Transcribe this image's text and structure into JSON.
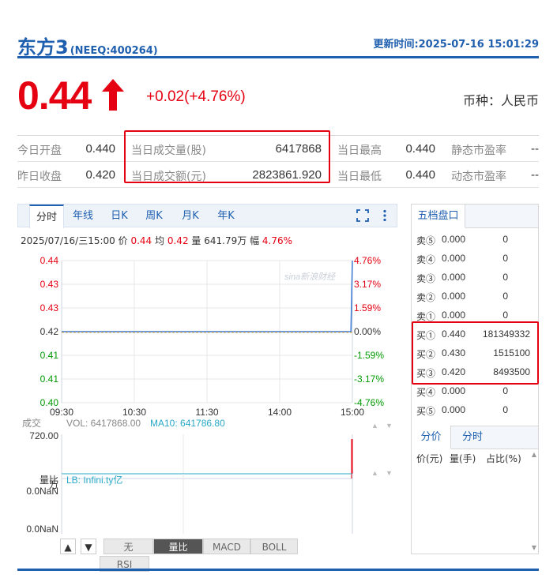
{
  "header": {
    "name": "东方3",
    "code": "(NEEQ:400264)",
    "update_time": "更新时间:2025-07-16 15:01:29"
  },
  "quote": {
    "price": "0.44",
    "change": "+0.02(+4.76%)",
    "currency": "币种：人民币"
  },
  "stats": {
    "row1": [
      {
        "label": "今日开盘",
        "value": "0.440"
      },
      {
        "label": "当日成交量(股)",
        "value": "6417868"
      },
      {
        "label": "当日最高",
        "value": "0.440"
      },
      {
        "label": "静态市盈率",
        "value": "--"
      }
    ],
    "row2": [
      {
        "label": "昨日收盘",
        "value": "0.420"
      },
      {
        "label": "当日成交额(元)",
        "value": "2823861.920"
      },
      {
        "label": "当日最低",
        "value": "0.440"
      },
      {
        "label": "动态市盈率",
        "value": "--"
      }
    ]
  },
  "chart_tabs": [
    "分时",
    "年线",
    "日K",
    "周K",
    "月K",
    "年K"
  ],
  "info_line": {
    "date": "2025/07/16/三15:00",
    "price_label": "价",
    "price": "0.44",
    "avg_label": "均",
    "avg": "0.42",
    "vol_label": "量",
    "vol": "641.79万",
    "range_label": "幅",
    "range": "4.76%"
  },
  "watermark": "sina新浪财经",
  "chart_data": [
    {
      "type": "line",
      "x_ticks": [
        "09:30",
        "10:30",
        "11:30",
        "14:00",
        "15:00"
      ],
      "y_ticks_left": [
        "0.44",
        "0.43",
        "0.43",
        "0.42",
        "0.41",
        "0.41",
        "0.40"
      ],
      "y_ticks_right": [
        "4.76%",
        "3.17%",
        "1.59%",
        "0.00%",
        "-1.59%",
        "-3.17%",
        "-4.76%"
      ],
      "ylim": [
        0.4,
        0.44
      ],
      "baseline": 0.42,
      "series": [
        {
          "values_x": [
            0,
            0.995,
            1.0
          ],
          "values": [
            0.42,
            0.42,
            0.44
          ]
        }
      ]
    },
    {
      "type": "bar",
      "label": "成交",
      "volume_text": "VOL: 6417868.00",
      "ma_text": "MA10: 641786.80",
      "y_top": "720.00",
      "unit": "万",
      "bars": [
        {
          "x": 1.0,
          "value": 641.79
        }
      ]
    }
  ],
  "indicator": {
    "label": "量比",
    "lb_text": "LB: Infini.ty亿",
    "y1": "0.0NaN",
    "y2": "0.0NaN"
  },
  "indicator_buttons": [
    "无",
    "量比",
    "MACD",
    "BOLL",
    "RSI"
  ],
  "side_tabs": [
    "五档盘口"
  ],
  "order_book": [
    {
      "label": "卖⑤",
      "price": "0.000",
      "vol": "0"
    },
    {
      "label": "卖④",
      "price": "0.000",
      "vol": "0"
    },
    {
      "label": "卖③",
      "price": "0.000",
      "vol": "0"
    },
    {
      "label": "卖②",
      "price": "0.000",
      "vol": "0"
    },
    {
      "label": "卖①",
      "price": "0.000",
      "vol": "0"
    },
    {
      "label": "买①",
      "price": "0.440",
      "vol": "181349332"
    },
    {
      "label": "买②",
      "price": "0.430",
      "vol": "1515100"
    },
    {
      "label": "买③",
      "price": "0.420",
      "vol": "8493500"
    },
    {
      "label": "买④",
      "price": "0.000",
      "vol": "0"
    },
    {
      "label": "买⑤",
      "price": "0.000",
      "vol": "0"
    }
  ],
  "detail_tabs": [
    "分价",
    "分时"
  ],
  "detail_headers": [
    "价(元)",
    "量(手)",
    "占比(%)"
  ],
  "colors": {
    "brand": "#1f5faf",
    "up": "#e50012",
    "down": "#009900",
    "highlight": "#e50012"
  }
}
